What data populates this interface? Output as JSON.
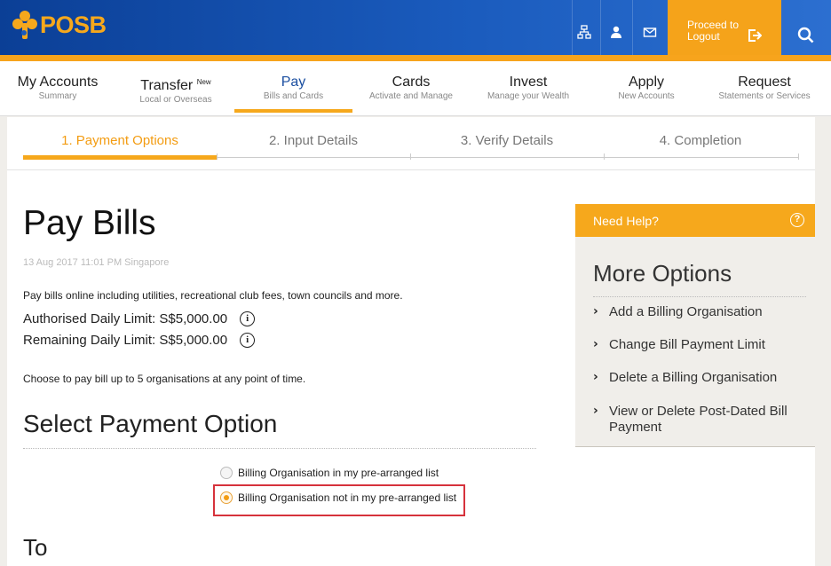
{
  "brand": {
    "name": "POSB"
  },
  "topbar": {
    "icons": [
      "sitemap-icon",
      "profile-icon",
      "mail-icon"
    ],
    "logout_label": "Proceed to Logout",
    "accent": "#f5a31a"
  },
  "nav": {
    "items": [
      {
        "label": "My Accounts",
        "sub": "Summary"
      },
      {
        "label": "Transfer",
        "badge": "New",
        "sub": "Local or Overseas"
      },
      {
        "label": "Pay",
        "sub": "Bills and Cards"
      },
      {
        "label": "Cards",
        "sub": "Activate and Manage"
      },
      {
        "label": "Invest",
        "sub": "Manage your Wealth"
      },
      {
        "label": "Apply",
        "sub": "New Accounts"
      },
      {
        "label": "Request",
        "sub": "Statements or Services"
      }
    ],
    "active": "Pay"
  },
  "steps": [
    {
      "label": "1. Payment Options"
    },
    {
      "label": "2. Input Details"
    },
    {
      "label": "3. Verify Details"
    },
    {
      "label": "4. Completion"
    }
  ],
  "page": {
    "title": "Pay Bills",
    "date": "13 Aug 2017 11:01 PM Singapore",
    "description": "Pay bills online including utilities, recreational club fees, town councils and more.",
    "authorised_limit": "Authorised Daily Limit: S$5,000.00",
    "remaining_limit": "Remaining Daily Limit: S$5,000.00",
    "choose_text": "Choose to pay bill up to 5 organisations at any point of time.",
    "section_title": "Select Payment Option",
    "options": [
      {
        "label": "Billing Organisation in my pre-arranged list",
        "selected": false
      },
      {
        "label": "Billing Organisation not in my pre-arranged list",
        "selected": true
      }
    ],
    "to_label": "To"
  },
  "sidepanel": {
    "help_label": "Need Help?",
    "more_title": "More Options",
    "links": [
      "Add a Billing Organisation",
      "Change Bill Payment Limit",
      "Delete a Billing Organisation",
      "View or Delete Post-Dated Bill Payment"
    ]
  }
}
